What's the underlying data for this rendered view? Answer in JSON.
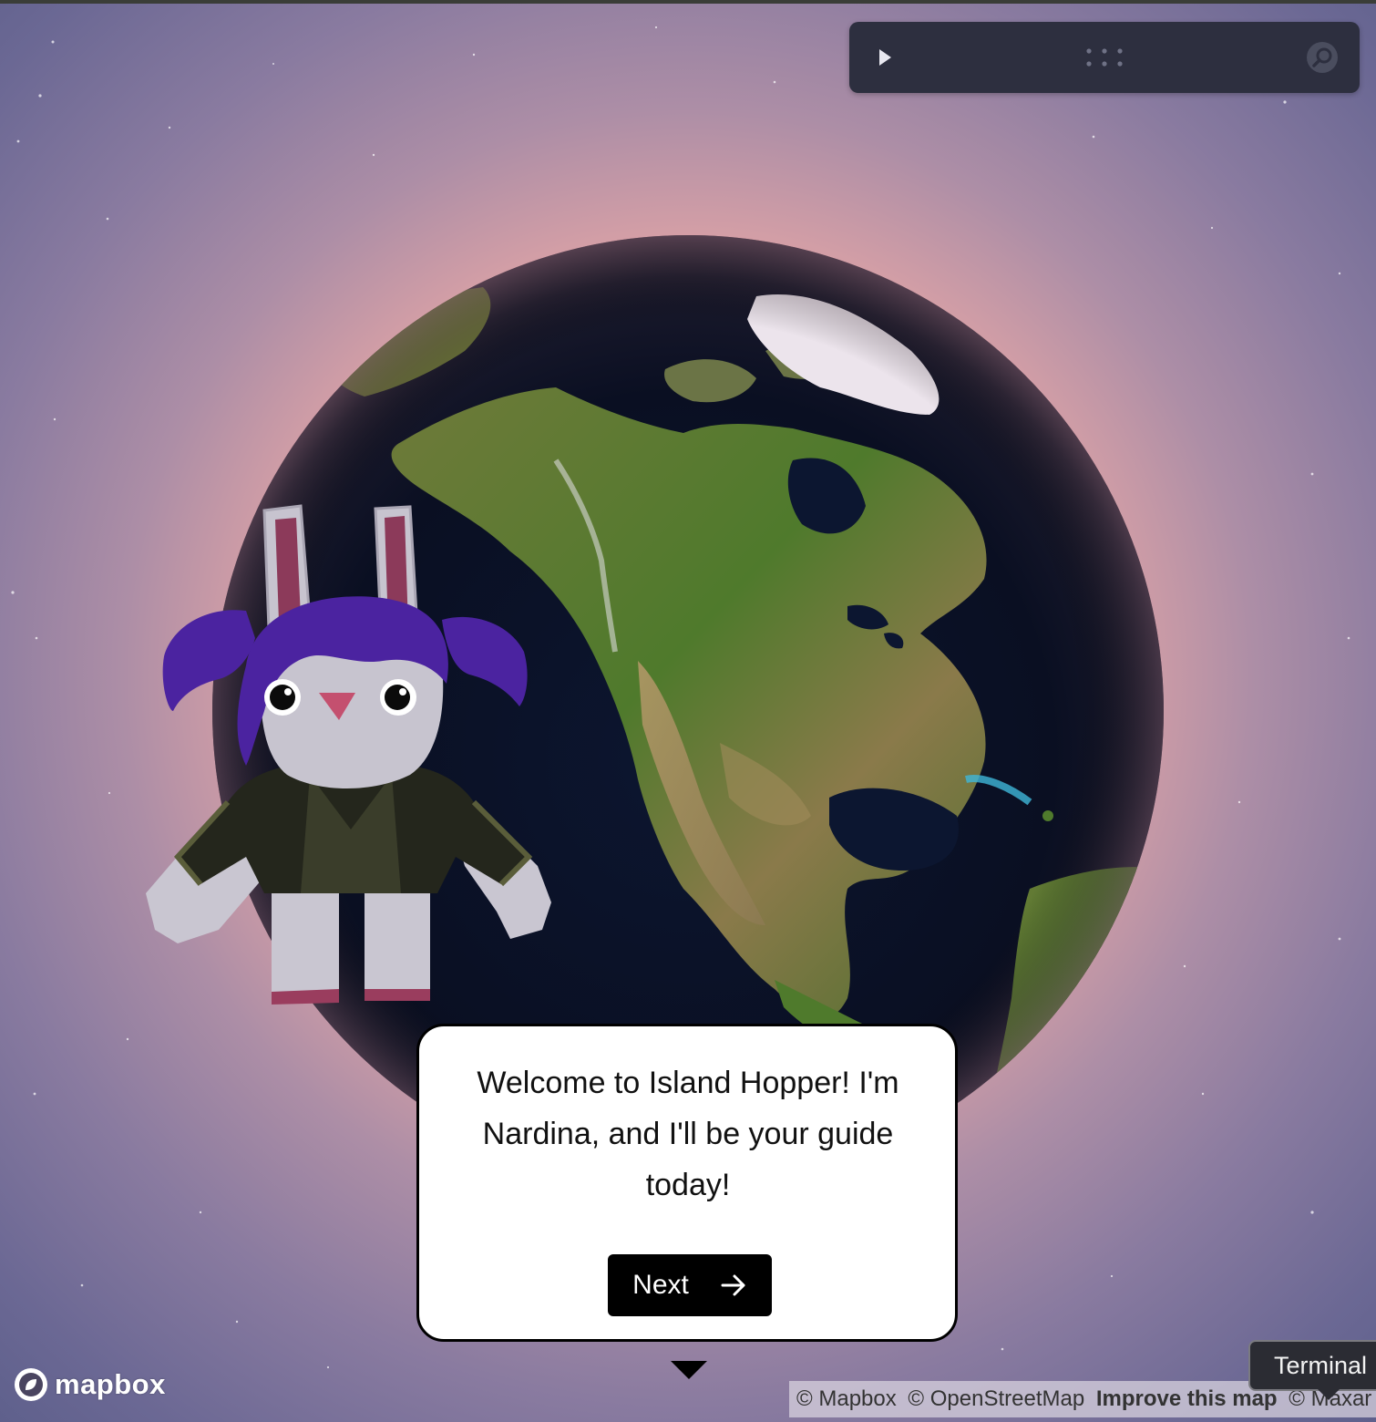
{
  "app": {
    "name": "Island Hopper"
  },
  "controls": {
    "play_icon": "play-icon",
    "drag_icon": "drag-handle-icon",
    "search_icon": "search-icon"
  },
  "guide": {
    "character": "Nardina",
    "message": "Welcome to Island Hopper! I'm Nardina, and I'll be your guide today!",
    "next_label": "Next",
    "next_icon": "arrow-right-icon"
  },
  "map": {
    "logo_text": "mapbox",
    "attribution": {
      "mapbox": "© Mapbox",
      "osm": "© OpenStreetMap",
      "improve": "Improve this map",
      "maxar": "© Maxar"
    }
  },
  "tooltip": {
    "text": "Terminal"
  },
  "colors": {
    "control_bar": "#2d2f3f",
    "dialog_bg": "#ffffff",
    "button_bg": "#000000",
    "hair": "#4b23a0",
    "jacket": "#24261c"
  }
}
